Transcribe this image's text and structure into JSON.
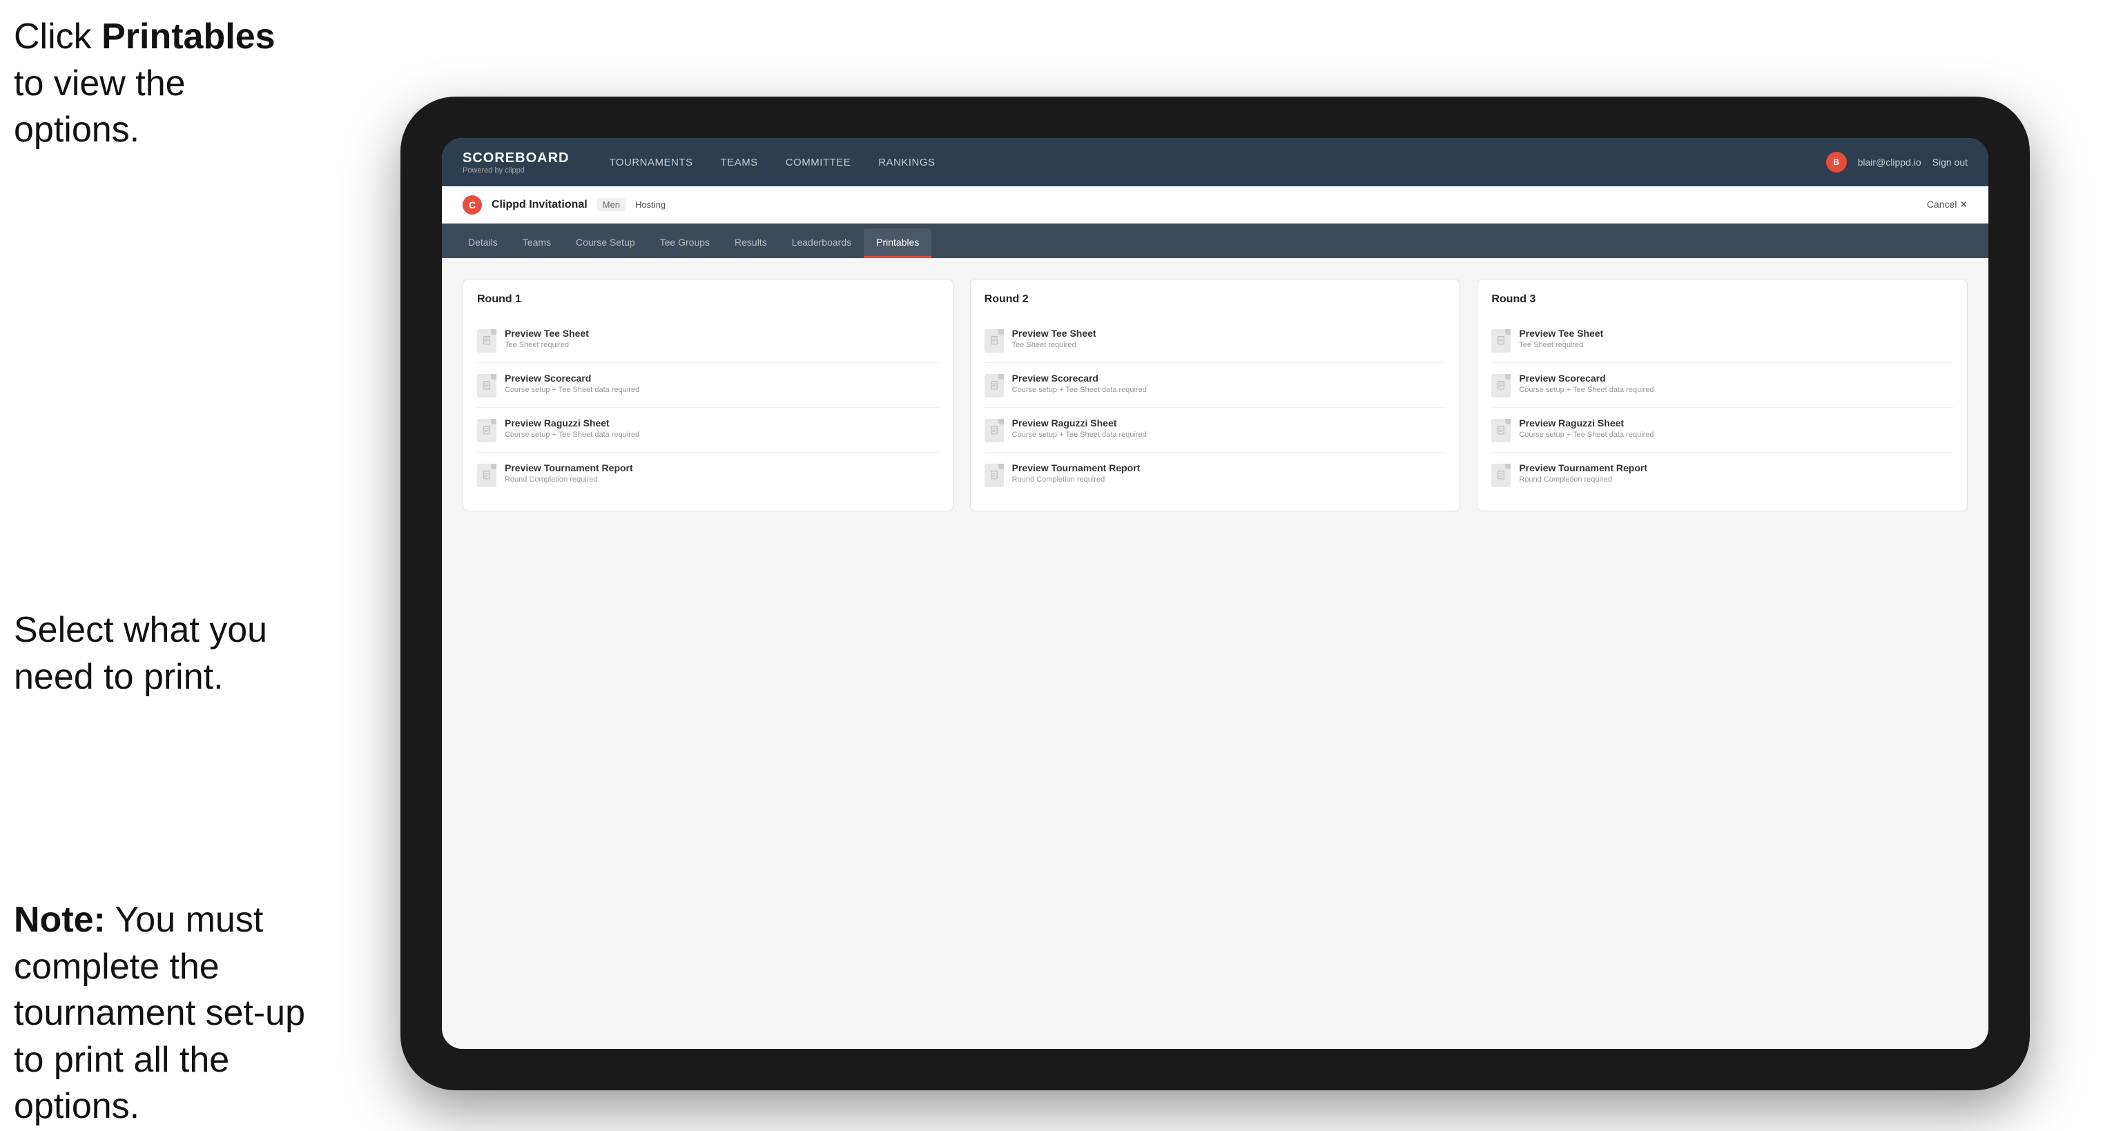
{
  "instructions": {
    "top": "Click ",
    "top_bold": "Printables",
    "top_rest": " to view the options.",
    "middle": "Select what you need to print.",
    "bottom_bold": "Note:",
    "bottom_rest": " You must complete the tournament set-up to print all the options."
  },
  "nav": {
    "logo": "SCOREBOARD",
    "logo_sub": "Powered by clippd",
    "links": [
      "TOURNAMENTS",
      "TEAMS",
      "COMMITTEE",
      "RANKINGS"
    ],
    "user_email": "blair@clippd.io",
    "sign_out": "Sign out"
  },
  "tournament": {
    "name": "Clippd Invitational",
    "tag": "Men",
    "status": "Hosting",
    "cancel": "Cancel  ✕"
  },
  "tabs": [
    {
      "label": "Details",
      "active": false
    },
    {
      "label": "Teams",
      "active": false
    },
    {
      "label": "Course Setup",
      "active": false
    },
    {
      "label": "Tee Groups",
      "active": false
    },
    {
      "label": "Results",
      "active": false
    },
    {
      "label": "Leaderboards",
      "active": false
    },
    {
      "label": "Printables",
      "active": true
    }
  ],
  "rounds": [
    {
      "title": "Round 1",
      "options": [
        {
          "label": "Preview Tee Sheet",
          "sublabel": "Tee Sheet required"
        },
        {
          "label": "Preview Scorecard",
          "sublabel": "Course setup + Tee Sheet data required"
        },
        {
          "label": "Preview Raguzzi Sheet",
          "sublabel": "Course setup + Tee Sheet data required"
        },
        {
          "label": "Preview Tournament Report",
          "sublabel": "Round Completion required"
        }
      ]
    },
    {
      "title": "Round 2",
      "options": [
        {
          "label": "Preview Tee Sheet",
          "sublabel": "Tee Sheet required"
        },
        {
          "label": "Preview Scorecard",
          "sublabel": "Course setup + Tee Sheet data required"
        },
        {
          "label": "Preview Raguzzi Sheet",
          "sublabel": "Course setup + Tee Sheet data required"
        },
        {
          "label": "Preview Tournament Report",
          "sublabel": "Round Completion required"
        }
      ]
    },
    {
      "title": "Round 3",
      "options": [
        {
          "label": "Preview Tee Sheet",
          "sublabel": "Tee Sheet required"
        },
        {
          "label": "Preview Scorecard",
          "sublabel": "Course setup + Tee Sheet data required"
        },
        {
          "label": "Preview Raguzzi Sheet",
          "sublabel": "Course setup + Tee Sheet data required"
        },
        {
          "label": "Preview Tournament Report",
          "sublabel": "Round Completion required"
        }
      ]
    }
  ],
  "colors": {
    "accent": "#e74c3c",
    "nav_bg": "#2c3e50",
    "tab_bg": "#3d4a5c",
    "active_tab": "#e74c3c"
  }
}
